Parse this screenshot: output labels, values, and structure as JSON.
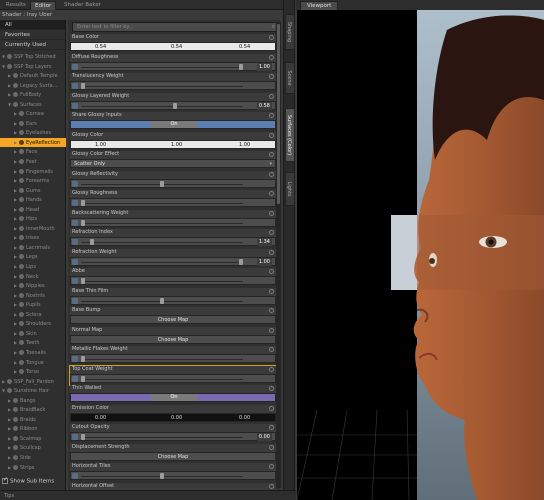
{
  "top_tabs": [
    "Results",
    "Editor",
    "Shader Baker"
  ],
  "active_top_tab": "Editor",
  "shader_label": "Shader : Iray Uber",
  "filters": [
    "All",
    "Favorites",
    "Currently Used"
  ],
  "tree": [
    {
      "label": "SSP Top Stitched",
      "indent": 0,
      "expanded": true
    },
    {
      "label": "SSP Top Layers",
      "indent": 0,
      "expanded": true
    },
    {
      "label": "Default Temple",
      "indent": 1
    },
    {
      "label": "Legacy Surfa...",
      "indent": 1
    },
    {
      "label": "FullBody",
      "indent": 1
    },
    {
      "label": "Surfaces",
      "indent": 1,
      "expanded": true
    },
    {
      "label": "Cornea",
      "indent": 2
    },
    {
      "label": "Ears",
      "indent": 2
    },
    {
      "label": "Eyelashes",
      "indent": 2
    },
    {
      "label": "EyeReflection",
      "indent": 2,
      "active": true
    },
    {
      "label": "Face",
      "indent": 2
    },
    {
      "label": "Feet",
      "indent": 2
    },
    {
      "label": "Fingernails",
      "indent": 2
    },
    {
      "label": "Forearms",
      "indent": 2
    },
    {
      "label": "Gums",
      "indent": 2
    },
    {
      "label": "Hands",
      "indent": 2
    },
    {
      "label": "Head",
      "indent": 2
    },
    {
      "label": "Hips",
      "indent": 2
    },
    {
      "label": "InnerMouth",
      "indent": 2
    },
    {
      "label": "Irises",
      "indent": 2
    },
    {
      "label": "Lacrimals",
      "indent": 2
    },
    {
      "label": "Legs",
      "indent": 2
    },
    {
      "label": "Lips",
      "indent": 2
    },
    {
      "label": "Neck",
      "indent": 2
    },
    {
      "label": "Nipples",
      "indent": 2
    },
    {
      "label": "Nostrils",
      "indent": 2
    },
    {
      "label": "Pupils",
      "indent": 2
    },
    {
      "label": "Sclera",
      "indent": 2
    },
    {
      "label": "Shoulders",
      "indent": 2
    },
    {
      "label": "Skin",
      "indent": 2
    },
    {
      "label": "Teeth",
      "indent": 2
    },
    {
      "label": "Toenails",
      "indent": 2
    },
    {
      "label": "Tongue",
      "indent": 2
    },
    {
      "label": "Torso",
      "indent": 2
    },
    {
      "label": "SSP_Fall_Pardon",
      "indent": 0
    },
    {
      "label": "Sunshine Hair",
      "indent": 0,
      "expanded": true
    },
    {
      "label": "Bangs",
      "indent": 1
    },
    {
      "label": "BraidBack",
      "indent": 1
    },
    {
      "label": "Braids",
      "indent": 1
    },
    {
      "label": "Ribbon",
      "indent": 1
    },
    {
      "label": "Scalmap",
      "indent": 1
    },
    {
      "label": "Scullcap",
      "indent": 1
    },
    {
      "label": "Side",
      "indent": 1
    },
    {
      "label": "Strips",
      "indent": 1
    }
  ],
  "show_sub_items": "Show Sub Items",
  "filter_placeholder": "Enter text to filter by...",
  "properties": [
    {
      "label": "Base Color",
      "kind": "color",
      "bg": "white",
      "values": [
        "0.54",
        "0.54",
        "0.54"
      ]
    },
    {
      "label": "Diffuse Roughness",
      "kind": "slider",
      "value": "1.00",
      "pos": 1.0
    },
    {
      "label": "Translucency Weight",
      "kind": "slider",
      "value": "",
      "pos": 0.0
    },
    {
      "label": "Glossy Layered Weight",
      "kind": "slider",
      "value": "0.58",
      "pos": 0.58
    },
    {
      "label": "Share Glossy Inputs",
      "kind": "toggle",
      "value": "On",
      "color": "blue"
    },
    {
      "label": "Glossy Color",
      "kind": "color",
      "bg": "white",
      "values": [
        "1.00",
        "1.00",
        "1.00"
      ]
    },
    {
      "label": "Glossy Color Effect",
      "kind": "dropdown",
      "value": "Scatter Only"
    },
    {
      "label": "Glossy Reflectivity",
      "kind": "slider",
      "value": "",
      "pos": 0.5
    },
    {
      "label": "Glossy Roughness",
      "kind": "slider",
      "value": "",
      "pos": 0.0
    },
    {
      "label": "Backscattering Weight",
      "kind": "slider",
      "value": "",
      "pos": 0.0
    },
    {
      "label": "Refraction Index",
      "kind": "slider",
      "value": "1.34",
      "pos": 0.06
    },
    {
      "label": "Refraction Weight",
      "kind": "slider",
      "value": "1.00",
      "pos": 1.0
    },
    {
      "label": "Abbe",
      "kind": "slider",
      "value": "",
      "pos": 0.0
    },
    {
      "label": "Base Thin Film",
      "kind": "slider",
      "value": "",
      "pos": 0.5
    },
    {
      "label": "Base Bump",
      "kind": "map",
      "value": "Choose Map"
    },
    {
      "label": "Normal Map",
      "kind": "map",
      "value": "Choose Map"
    },
    {
      "label": "Metallic Flakes Weight",
      "kind": "slider",
      "value": "",
      "pos": 0.0
    },
    {
      "label": "Top Coat Weight",
      "kind": "slider",
      "value": "",
      "pos": 0.0,
      "highlight": true
    },
    {
      "label": "Thin Walled",
      "kind": "toggle",
      "value": "On",
      "color": "purple"
    },
    {
      "label": "Emission Color",
      "kind": "color",
      "bg": "black",
      "values": [
        "0.00",
        "0.00",
        "0.00"
      ]
    },
    {
      "label": "Cutout Opacity",
      "kind": "slider",
      "value": "0.00",
      "pos": 0.0
    },
    {
      "label": "Displacement Strength",
      "kind": "map",
      "value": "Choose Map"
    },
    {
      "label": "Horizontal Tiles",
      "kind": "slider",
      "value": "",
      "pos": 0.5
    },
    {
      "label": "Horizontal Offset",
      "kind": "slider",
      "value": "",
      "pos": 0.5
    }
  ],
  "side_tabs": [
    "Shaping",
    "Scene",
    "Surfaces (Color)",
    "Lights"
  ],
  "active_side_tab": "Surfaces (Color)",
  "viewport_tab": "Viewport",
  "bottom_text": "Tips"
}
